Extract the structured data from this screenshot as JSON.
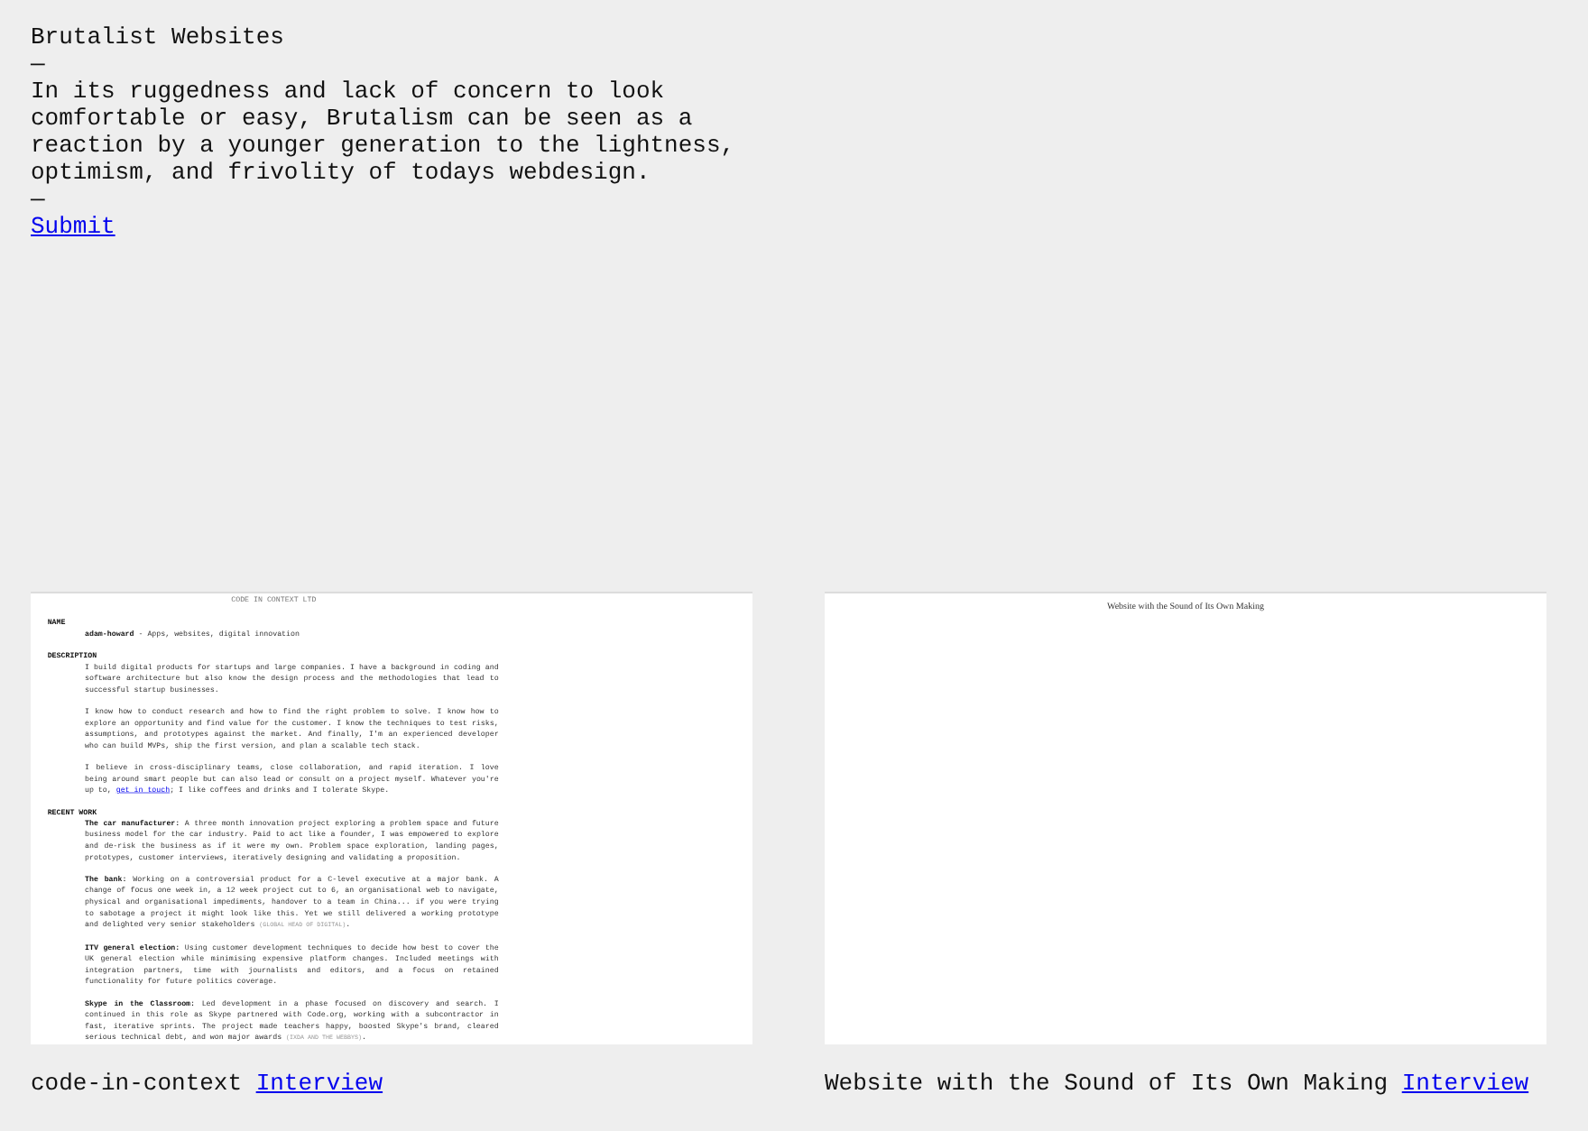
{
  "header": {
    "title": "Brutalist Websites",
    "separator_top": "—",
    "description": "In its ruggedness and lack of concern to look comfortable or easy, Brutalism can be seen as a reaction by a younger generation to the lightness, optimism, and frivolity of todays webdesign.",
    "separator_bottom": "—",
    "submit_link": "Submit"
  },
  "sites": [
    {
      "screenshot": {
        "kind": "document",
        "heading": "CODE IN CONTEXT LTD",
        "sections": [
          {
            "heading": "NAME",
            "paragraphs": [
              [
                {
                  "kind": "text",
                  "text": "**adam-howard** - Apps, websites, digital innovation"
                }
              ]
            ]
          },
          {
            "heading": "DESCRIPTION",
            "paragraphs": [
              [
                {
                  "kind": "text",
                  "text": "I build digital products for startups and large companies. I have a background in coding and software architecture but also know the design process and the methodologies that lead to successful startup businesses."
                }
              ],
              [
                {
                  "kind": "text",
                  "text": "I know how to conduct research and how to find the right problem to solve. I know how to explore an opportunity and find value for the customer. I know the techniques to test risks, assumptions, and prototypes against the market. And finally, I'm an experienced developer who can build MVPs, ship the first version, and plan a scalable tech stack."
                }
              ],
              [
                {
                  "kind": "text",
                  "text": "I believe in cross-disciplinary teams, close collaboration, and rapid iteration. I love being around smart people but can also lead or consult on a project myself. Whatever you're up to, "
                },
                {
                  "kind": "link",
                  "text": "get in touch"
                },
                {
                  "kind": "text",
                  "text": "; I like coffees and drinks and I tolerate Skype."
                }
              ]
            ]
          },
          {
            "heading": "RECENT WORK",
            "paragraphs": [
              [
                {
                  "kind": "text",
                  "text": "**The car manufacturer:** A three month innovation project exploring a problem space and future business model for the car industry. Paid to act like a founder, I was empowered to explore and de-risk the business as if it were my own. Problem space exploration, landing pages, prototypes, customer interviews, iteratively designing and validating a proposition."
                }
              ],
              [
                {
                  "kind": "text",
                  "text": "**The bank:** Working on a controversial product for a C-level executive at a major bank. A change of focus one week in, a 12 week project cut to 6, an organisational web to navigate, physical and organisational impediments, handover to a team in China... if you were trying to sabotage a project it might look like this. Yet we still delivered a working prototype and delighted very senior stakeholders "
                },
                {
                  "kind": "note",
                  "text": "(GLOBAL HEAD OF DIGITAL)"
                },
                {
                  "kind": "text",
                  "text": "."
                }
              ],
              [
                {
                  "kind": "text",
                  "text": "**ITV general election:** Using customer development techniques to decide how best to cover the UK general election while minimising expensive platform changes. Included meetings with integration partners, time with journalists and editors, and a focus on retained functionality for future politics coverage."
                }
              ],
              [
                {
                  "kind": "text",
                  "text": "**Skype in the Classroom:** Led development in a phase focused on discovery and search. I continued in this role as Skype partnered with Code.org, working with a subcontractor in fast, iterative sprints. The project made teachers happy, boosted Skype's brand, cleared serious technical debt, and won major awards "
                },
                {
                  "kind": "note",
                  "text": "(IXDA AND THE WEBBYS)"
                },
                {
                  "kind": "text",
                  "text": "."
                }
              ]
            ]
          }
        ]
      },
      "name": "code-in-context",
      "link": "Interview"
    },
    {
      "screenshot": {
        "kind": "blank",
        "heading": "Website with the Sound of Its Own Making"
      },
      "name": "Website with the Sound of Its Own Making",
      "link": "Interview"
    }
  ]
}
